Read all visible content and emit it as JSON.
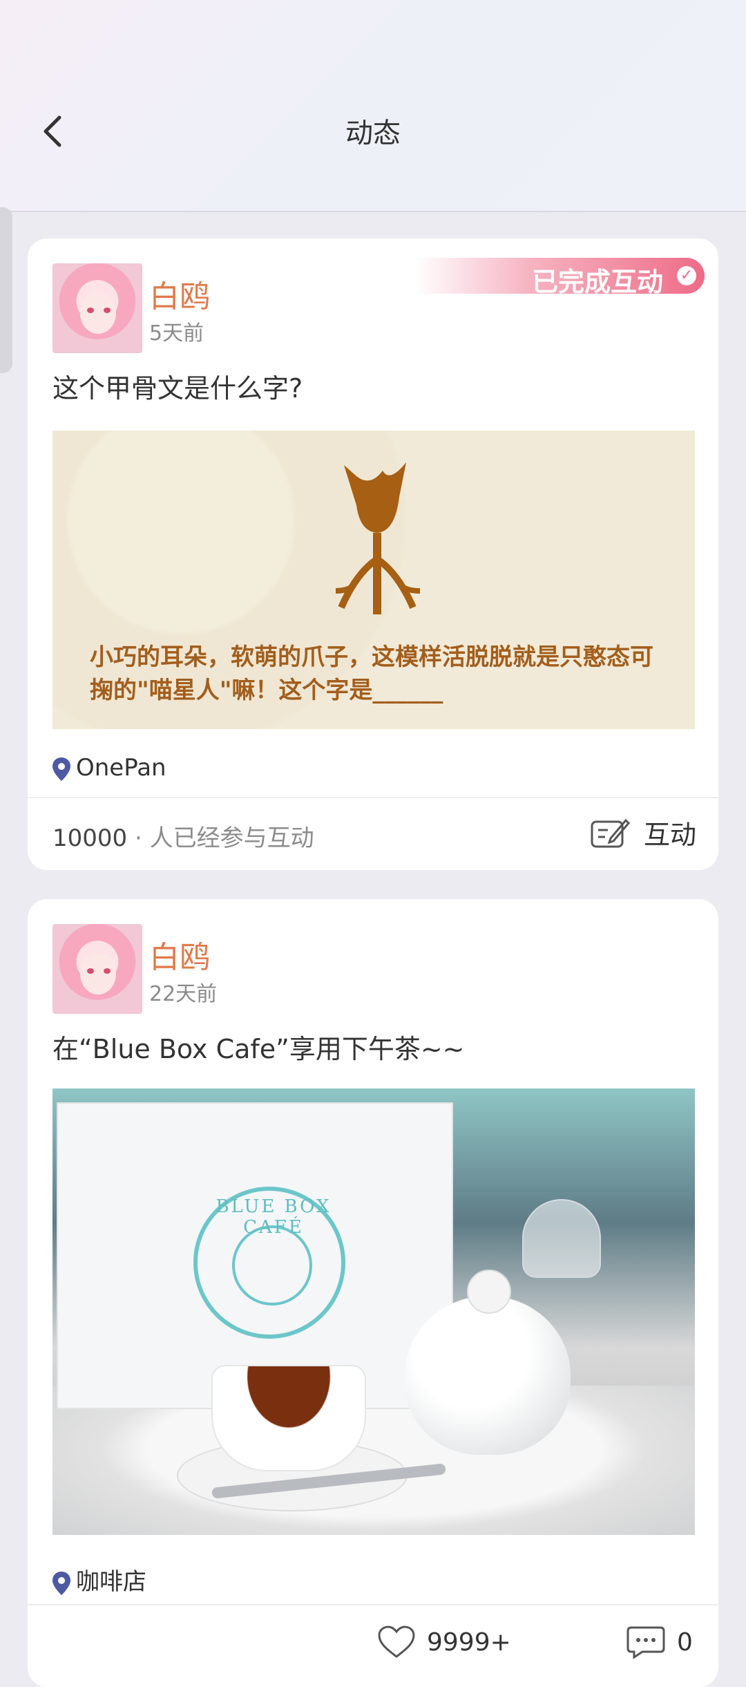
{
  "header": {
    "title": "动态"
  },
  "posts": [
    {
      "user_name": "白鸥",
      "time": "5天前",
      "badge": "已完成互动",
      "text": "这个甲骨文是什么字?",
      "image_caption": "小巧的耳朵，软萌的爪子，这模样活脱脱就是只憨态可掬的\"喵星人\"嘛！这个字是______",
      "location": "OnePan",
      "participants_count": "10000",
      "participants_suffix": "· 人已经参与互动",
      "action_label": "互动"
    },
    {
      "user_name": "白鸥",
      "time": "22天前",
      "text": "在“Blue Box Cafe”享用下午茶~~",
      "image_logo_text": "BLUE BOX CAFÉ",
      "location": "咖啡店",
      "likes": "9999+",
      "comments": "0"
    }
  ],
  "colors": {
    "name": "#e07a4a",
    "badge": "#ee6b86",
    "pin": "#4d5aa3"
  }
}
